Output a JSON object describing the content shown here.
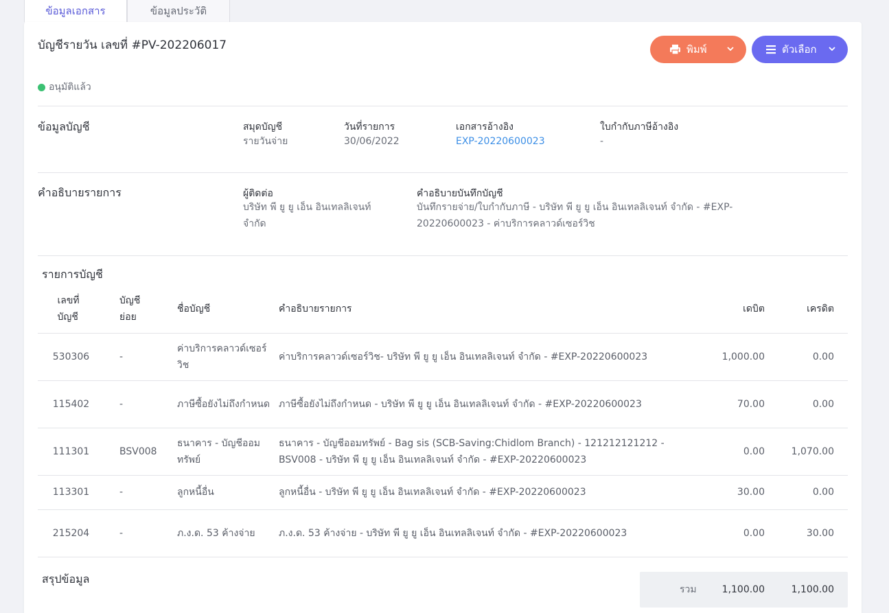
{
  "tabs": [
    "ข้อมูลเอกสาร",
    "ข้อมูลประวัติ"
  ],
  "header": {
    "title": "บัญชีรายวัน เลขที่ #PV-202206017",
    "print_label": "พิมพ์",
    "options_label": "ตัวเลือก",
    "status": "อนุมัติแล้ว"
  },
  "account_info": {
    "section_title": "ข้อมูลบัญชี",
    "journal_label": "สมุดบัญชี",
    "journal_value": "รายวันจ่าย",
    "date_label": "วันที่รายการ",
    "date_value": "30/06/2022",
    "ref_doc_label": "เอกสารอ้างอิง",
    "ref_doc_value": "EXP-20220600023",
    "tax_ref_label": "ใบกำกับภาษีอ้างอิง",
    "tax_ref_value": "-"
  },
  "description": {
    "section_title": "คำอธิบายรายการ",
    "contact_label": "ผู้ติดต่อ",
    "contact_value": "บริษัท พี ยู ยู เอ็น อินเทลลิเจนท์ จำกัด",
    "note_label": "คำอธิบายบันทึกบัญชี",
    "note_value": "บันทึกรายจ่าย/ใบกำกับภาษี - บริษัท พี ยู ยู เอ็น อินเทลลิเจนท์ จำกัด - #EXP-20220600023 - ค่าบริการคลาวด์เซอร์วิช"
  },
  "entries": {
    "section_title": "รายการบัญชี",
    "columns": {
      "account_no": "เลขที่ บัญชี",
      "sub_account": "บัญชี ย่อย",
      "account_name": "ชื่อบัญชี",
      "description": "คำอธิบายรายการ",
      "debit": "เดบิต",
      "credit": "เครดิต"
    },
    "rows": [
      {
        "no": "530306",
        "sub": "-",
        "name": "ค่าบริการคลาวด์เซอร์วิช",
        "desc": "ค่าบริการคลาวด์เซอร์วิช- บริษัท พี ยู ยู เอ็น อินเทลลิเจนท์ จำกัด - #EXP-20220600023",
        "debit": "1,000.00",
        "credit": "0.00"
      },
      {
        "no": "115402",
        "sub": "-",
        "name": "ภาษีซื้อยังไม่ถึงกำหนด",
        "desc": "ภาษีซื้อยังไม่ถึงกำหนด - บริษัท พี ยู ยู เอ็น อินเทลลิเจนท์ จำกัด - #EXP-20220600023",
        "debit": "70.00",
        "credit": "0.00"
      },
      {
        "no": "111301",
        "sub": "BSV008",
        "name": "ธนาคาร - บัญชีออมทรัพย์",
        "desc": "ธนาคาร - บัญชีออมทรัพย์ - Bag sis (SCB-Saving:Chidlom Branch) - 121212121212 - BSV008 - บริษัท พี ยู ยู เอ็น อินเทลลิเจนท์ จำกัด - #EXP-20220600023",
        "debit": "0.00",
        "credit": "1,070.00"
      },
      {
        "no": "113301",
        "sub": "-",
        "name": "ลูกหนี้อื่น",
        "desc": "ลูกหนี้อื่น - บริษัท พี ยู ยู เอ็น อินเทลลิเจนท์ จำกัด - #EXP-20220600023",
        "debit": "30.00",
        "credit": "0.00"
      },
      {
        "no": "215204",
        "sub": "-",
        "name": "ภ.ง.ด. 53 ค้างจ่าย",
        "desc": "ภ.ง.ด. 53 ค้างจ่าย - บริษัท พี ยู ยู เอ็น อินเทลลิเจนท์ จำกัด - #EXP-20220600023",
        "debit": "0.00",
        "credit": "30.00"
      }
    ]
  },
  "summary": {
    "section_title": "สรุปข้อมูล",
    "total_label": "รวม",
    "total_debit": "1,100.00",
    "total_credit": "1,100.00"
  },
  "colors": {
    "print_button": "#f47a5a",
    "options_button": "#6a6af0",
    "approved": "#3cc173",
    "link": "#3b8ee6"
  }
}
